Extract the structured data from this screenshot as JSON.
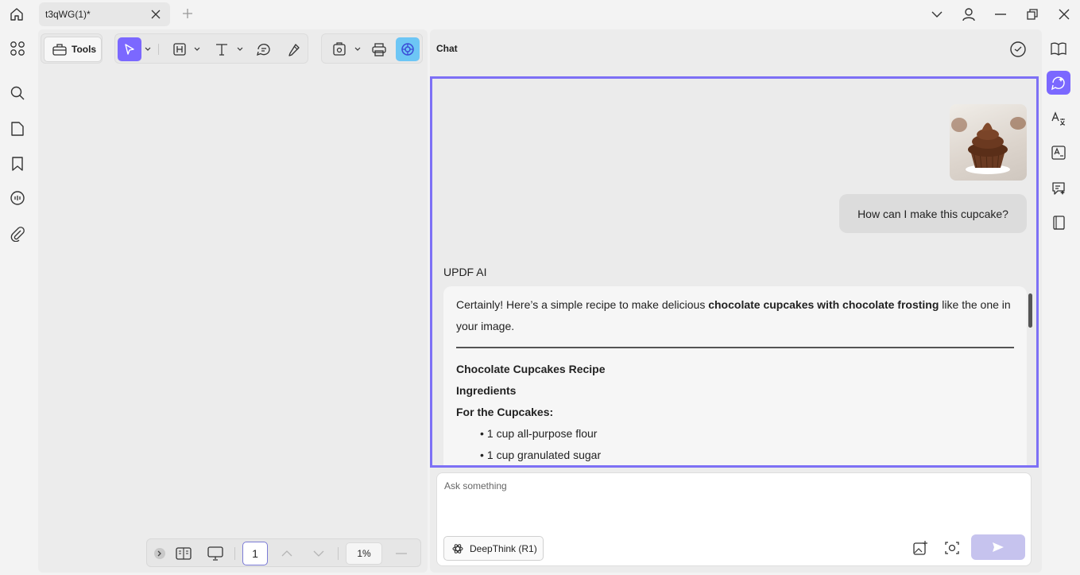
{
  "titlebar": {
    "tab_title": "t3qWG(1)*"
  },
  "toolbar": {
    "tools_label": "Tools"
  },
  "bottombar": {
    "page_number": "1",
    "zoom": "1%"
  },
  "chat": {
    "title": "Chat",
    "user_message": "How can I make this cupcake?",
    "ai_name": "UPDF AI",
    "ai_intro_pre": "Certainly! Here’s a simple recipe to make delicious ",
    "ai_intro_bold": "chocolate cupcakes with chocolate frosting",
    "ai_intro_post": " like the one in your image.",
    "recipe_title": "Chocolate Cupcakes Recipe",
    "ingredients_heading": "Ingredients",
    "cupcakes_heading": "For the Cupcakes:",
    "items": [
      "1 cup all-purpose flour",
      "1 cup granulated sugar"
    ],
    "input_placeholder": "Ask something",
    "deepthink_label": "DeepThink (R1)"
  },
  "colors": {
    "accent": "#7b68ff",
    "frame_border": "#7d70f5",
    "send_disabled": "#c6c3ee"
  }
}
